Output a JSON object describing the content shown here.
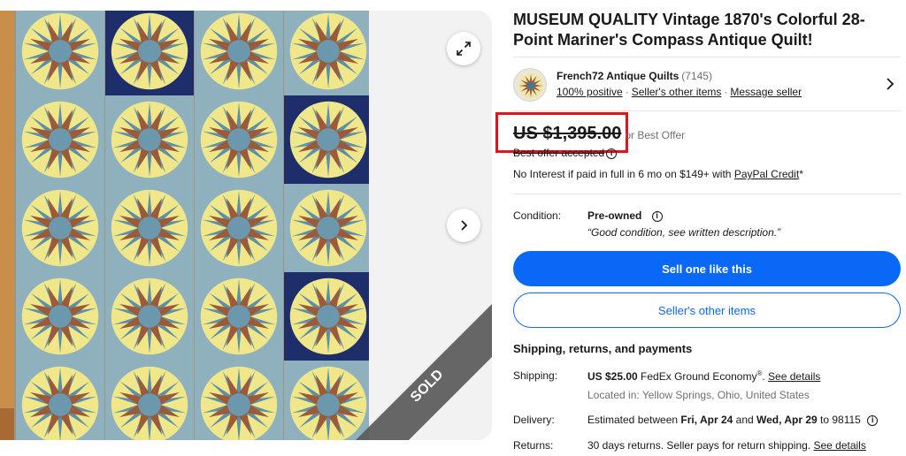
{
  "gallery": {
    "sold_badge": "SOLD",
    "expand_icon": "expand-icon",
    "next_icon": "chevron-right-icon"
  },
  "listing": {
    "title": "MUSEUM QUALITY Vintage 1870's Colorful 28-Point Mariner's Compass Antique Quilt!"
  },
  "seller": {
    "name": "French72 Antique Quilts",
    "feedback_count": "(7145)",
    "positive": "100% positive",
    "other_items": "Seller's other items",
    "message": "Message seller",
    "separator": "·"
  },
  "price": {
    "amount": "US $1,395.00",
    "or_best_offer": "or Best Offer",
    "offer_status": "Best offer accepted",
    "credit_prefix": "No Interest if paid in full in 6 mo on $149+ with ",
    "credit_link": "PayPal Credit",
    "credit_suffix": "*"
  },
  "condition": {
    "label": "Condition:",
    "value": "Pre-owned",
    "note": "“Good condition, see written description.”"
  },
  "actions": {
    "sell_one": "Sell one like this",
    "other_items": "Seller's other items"
  },
  "shipping": {
    "heading": "Shipping, returns, and payments",
    "shipping_label": "Shipping:",
    "shipping_cost": "US $25.00",
    "shipping_service": " FedEx Ground Economy",
    "shipping_reg": "®",
    "shipping_details": "See details",
    "location": "Located in: Yellow Springs, Ohio, United States",
    "delivery_label": "Delivery:",
    "delivery_prefix": "Estimated between ",
    "delivery_start": "Fri, Apr 24",
    "delivery_and": " and ",
    "delivery_end": "Wed, Apr 29",
    "delivery_suffix": " to 98115",
    "returns_label": "Returns:",
    "returns_text": "30 days returns. Seller pays for return shipping. ",
    "returns_details": "See details"
  },
  "colors": {
    "accent_blue": "#0968f6",
    "highlight_red": "#e5121c",
    "quilt_yellow": "#efe78a",
    "quilt_navy": "#1d2e6b",
    "quilt_sky": "#5f8fa6",
    "quilt_rust": "#9b5a3a"
  }
}
